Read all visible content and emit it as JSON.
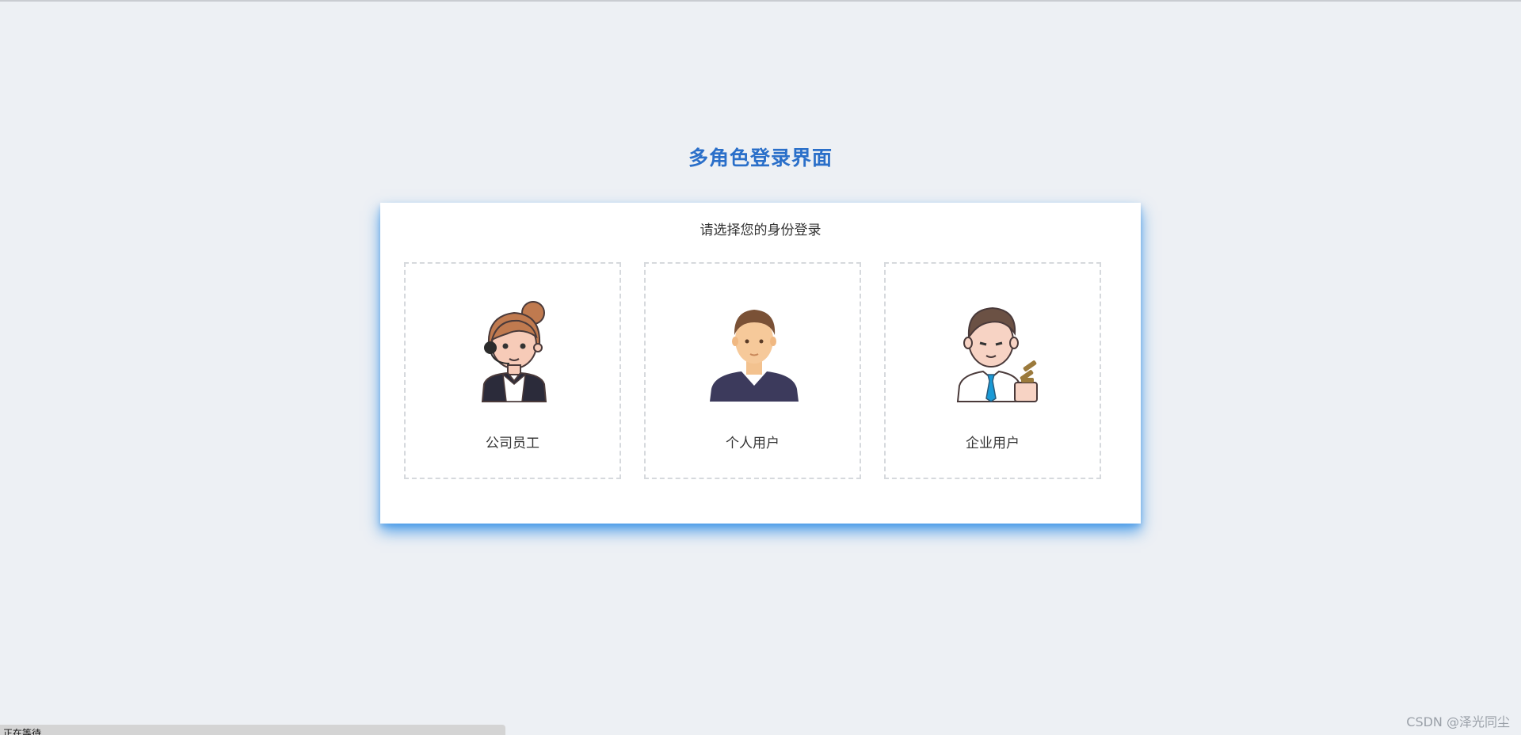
{
  "page": {
    "title": "多角色登录界面",
    "subtitle": "请选择您的身份登录"
  },
  "roles": [
    {
      "label": "公司员工",
      "icon": "employee-avatar-icon"
    },
    {
      "label": "个人用户",
      "icon": "personal-user-avatar-icon"
    },
    {
      "label": "企业用户",
      "icon": "enterprise-user-avatar-icon"
    }
  ],
  "status_bar": {
    "text": "正在等待 ..."
  },
  "watermark": "CSDN @泽光同尘",
  "colors": {
    "background": "#edf0f4",
    "title": "#2a6fc9",
    "card_shadow": "#2488e6",
    "tile_border": "#d6d9dd"
  }
}
